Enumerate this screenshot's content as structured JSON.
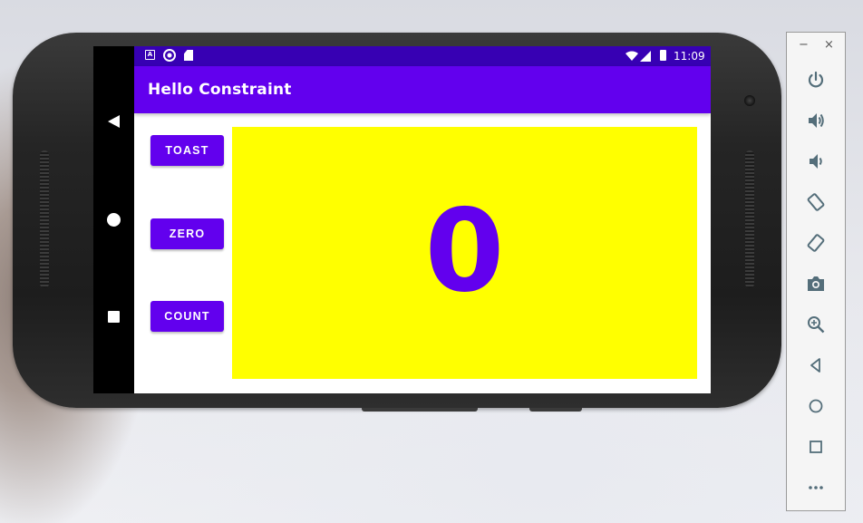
{
  "app": {
    "title": "Hello Constraint"
  },
  "statusbar": {
    "time": "11:09",
    "icons": [
      "a-notification-icon",
      "circle-notification-icon",
      "sd-card-icon",
      "wifi-icon",
      "signal-icon",
      "battery-icon"
    ]
  },
  "buttons": {
    "toast": "TOAST",
    "zero": "ZERO",
    "count": "COUNT"
  },
  "counter": {
    "value": "0"
  },
  "navbar": {
    "icons": [
      "back-icon",
      "home-icon",
      "recents-icon"
    ]
  },
  "emulator_toolbar": {
    "minimize": "−",
    "close": "×",
    "items": [
      "power-icon",
      "volume-up-icon",
      "volume-down-icon",
      "rotate-left-icon",
      "rotate-right-icon",
      "camera-icon",
      "zoom-icon",
      "back-icon",
      "home-icon",
      "overview-icon",
      "more-icon"
    ]
  },
  "colors": {
    "primary": "#6200ee",
    "primary_dark": "#3700b3",
    "panel": "#ffff00",
    "toolbar_icon": "#546e7a"
  }
}
